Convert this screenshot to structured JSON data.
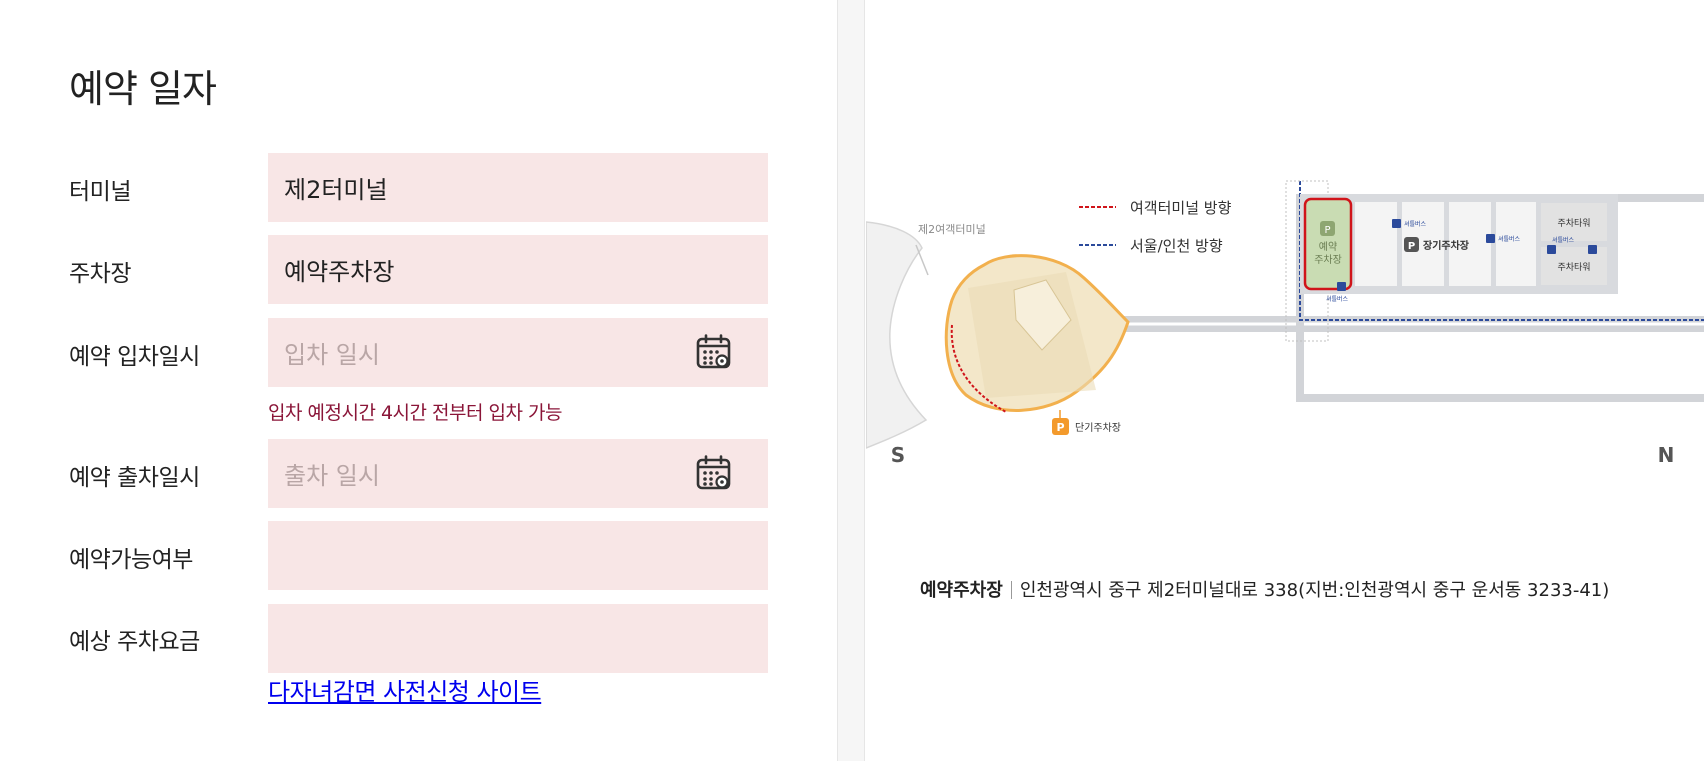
{
  "form": {
    "title": "예약 일자",
    "terminal": {
      "label": "터미널",
      "value": "제2터미널"
    },
    "parking": {
      "label": "주차장",
      "value": "예약주차장"
    },
    "entry": {
      "label": "예약 입차일시",
      "placeholder": "입차 일시",
      "note": "입차 예정시간 4시간 전부터 입차 가능"
    },
    "exit": {
      "label": "예약 출차일시",
      "placeholder": "출차 일시"
    },
    "availability": {
      "label": "예약가능여부",
      "value": ""
    },
    "fee": {
      "label": "예상 주차요금",
      "value": ""
    },
    "discount_link": "다자녀감면 사전신청 사이트"
  },
  "map": {
    "legend": {
      "passenger_terminal": "여객터미널 방향",
      "seoul_incheon": "서울/인천 방향"
    },
    "terminal_label": "제2여객터미널",
    "reserved_parking": [
      "예약",
      "주차장"
    ],
    "long_term_parking": "장기주차장",
    "short_term_parking": "단기주차장",
    "parking_tower": "주차타워",
    "shuttle_bus": "셔틀버스",
    "parking_sign": "P",
    "south": "S",
    "north": "N",
    "colors": {
      "terminal_route": "#d0141a",
      "seoul_route": "#2b4a9b",
      "reserved_fill": "#c9dcb3",
      "short_term_badge": "#f39a2c",
      "terminal_fill": "#f3e7c9",
      "terminal_outline": "#f2b04d"
    }
  },
  "address": {
    "name": "예약주차장",
    "text": "인천광역시 중구 제2터미널대로 338(지번:인천광역시 중구 운서동 3233-41)"
  }
}
